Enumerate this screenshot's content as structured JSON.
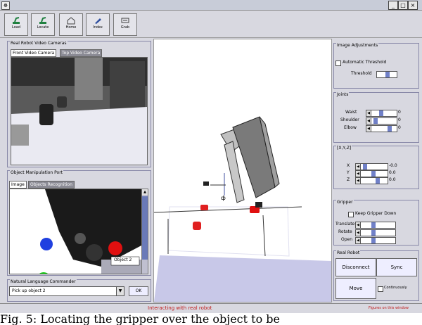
{
  "window": {
    "controls": [
      "_",
      "□",
      "×"
    ]
  },
  "toolbar": {
    "buttons": [
      {
        "label": "Load",
        "icon": "robot-arm-icon",
        "color": "#208040"
      },
      {
        "label": "Locate",
        "icon": "robot-arm-icon",
        "color": "#208040"
      },
      {
        "label": "Home",
        "icon": "home-icon",
        "color": "#404040"
      },
      {
        "label": "Index",
        "icon": "pen-icon",
        "color": "#3050a0"
      },
      {
        "label": "Grab",
        "icon": "gripper-icon",
        "color": "#404040"
      }
    ]
  },
  "cameras": {
    "title": "Real Robot Video Cameras",
    "tabs": [
      "Front Video Camera",
      "Top Video Camera"
    ]
  },
  "manipulation": {
    "title": "Object Manipulation Port",
    "tabs": [
      "Image",
      "Objects Recognition"
    ],
    "object_label": "Object 2"
  },
  "nlc": {
    "title": "Natural Language Commander",
    "command_value": "Pick up object 2",
    "ok_label": "OK"
  },
  "image_adjustments": {
    "title": "Image Adjustments",
    "auto_threshold_label": "Automatic Threshold",
    "threshold_label": "Threshold"
  },
  "joints": {
    "title": "Joints",
    "rows": [
      {
        "label": "Waist",
        "value": "0"
      },
      {
        "label": "Shoulder",
        "value": "0"
      },
      {
        "label": "Elbow",
        "value": "0"
      }
    ]
  },
  "xyz": {
    "title": "[X,Y,Z]",
    "rows": [
      {
        "label": "X",
        "value": "-0.0"
      },
      {
        "label": "Y",
        "value": "0.0"
      },
      {
        "label": "Z",
        "value": "0.0"
      }
    ]
  },
  "gripper": {
    "title": "Gripper",
    "keep_down_label": "Keep Gripper Down",
    "rows": [
      {
        "label": "Translate"
      },
      {
        "label": "Rotate"
      },
      {
        "label": "Open"
      }
    ]
  },
  "real_robot": {
    "title": "Real Robot",
    "disconnect_label": "Disconnect",
    "sync_label": "Sync",
    "move_label": "Move",
    "continuous_label": "Continuously"
  },
  "status": {
    "message": "Interacting with real robot",
    "right_text": "Figures on this window"
  },
  "caption": "Fig. 5: Locating the gripper over the object to be"
}
